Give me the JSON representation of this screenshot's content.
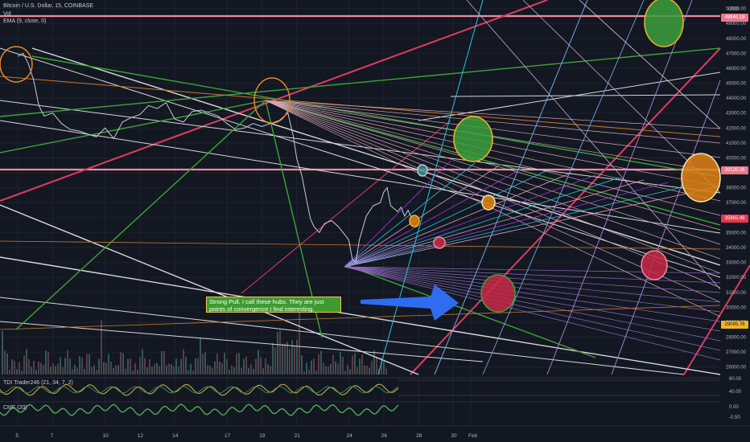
{
  "header": {
    "symbol_line": "Bitcoin / U.S. Dollar, 15, COINBASE",
    "vol_label": "Vol",
    "ema_label": "EMA (9, close, 0)",
    "currency": "USD"
  },
  "note": {
    "text": "Strong Pull. I call these hubs. They are just points of convergence I find interesting."
  },
  "indicators": {
    "tdi_label": "TDI Trader246 (21, 34, 7, 2)",
    "cmf_label": "CMF (20)"
  },
  "price_labels": [
    {
      "value": "48940.18",
      "color": "#e8788a"
    },
    {
      "value": "39120.26",
      "color": "#e8788a"
    },
    {
      "value": "35965.98",
      "color": "#e53950"
    },
    {
      "value": "29095.76",
      "color": "#f0b429"
    }
  ],
  "y_ticks": [
    "50000.00",
    "49000.00",
    "48000.00",
    "47000.00",
    "46000.00",
    "45000.00",
    "44000.00",
    "43000.00",
    "42000.00",
    "41000.00",
    "40000.00",
    "39000.00",
    "38000.00",
    "37000.00",
    "36000.00",
    "35000.00",
    "34000.00",
    "33000.00",
    "32000.00",
    "31000.00",
    "30000.00",
    "29000.00",
    "28000.00",
    "27000.00",
    "26000.00"
  ],
  "indicator_ticks": [
    "60.00",
    "40.00",
    "0.00",
    "-0.50"
  ],
  "x_ticks": [
    "5",
    "7",
    "10",
    "12",
    "14",
    "17",
    "19",
    "21",
    "24",
    "26",
    "28",
    "30",
    "Feb"
  ],
  "chart_data": {
    "type": "line",
    "title": "Bitcoin / U.S. Dollar, 15, COINBASE",
    "ylim": [
      25500,
      50300
    ],
    "y_scale": "linear",
    "grid": true,
    "price_points": [
      [
        5,
        46800
      ],
      [
        5.3,
        47000
      ],
      [
        5.6,
        46300
      ],
      [
        5.9,
        45200
      ],
      [
        6.2,
        43500
      ],
      [
        6.5,
        42800
      ],
      [
        7,
        43000
      ],
      [
        7.5,
        42300
      ],
      [
        8,
        41900
      ],
      [
        8.5,
        41800
      ],
      [
        9,
        41600
      ],
      [
        9.5,
        41400
      ],
      [
        10,
        42000
      ],
      [
        10.5,
        41300
      ],
      [
        11,
        42400
      ],
      [
        11.5,
        42700
      ],
      [
        12,
        42900
      ],
      [
        12.5,
        43500
      ],
      [
        13,
        43300
      ],
      [
        13.5,
        43700
      ],
      [
        14,
        42600
      ],
      [
        14.5,
        42400
      ],
      [
        15,
        43100
      ],
      [
        15.5,
        43200
      ],
      [
        16,
        43000
      ],
      [
        16.5,
        42800
      ],
      [
        17,
        42300
      ],
      [
        17.5,
        41900
      ],
      [
        18,
        42000
      ],
      [
        18.5,
        42300
      ],
      [
        19,
        42100
      ],
      [
        19.5,
        42300
      ],
      [
        20,
        42500
      ],
      [
        20.5,
        43000
      ],
      [
        20.8,
        41500
      ],
      [
        21,
        40000
      ],
      [
        21.3,
        38800
      ],
      [
        21.6,
        37000
      ],
      [
        21.8,
        35900
      ],
      [
        22,
        35400
      ],
      [
        22.3,
        35000
      ],
      [
        22.6,
        35600
      ],
      [
        23,
        35800
      ],
      [
        23.4,
        35400
      ],
      [
        23.8,
        34800
      ],
      [
        24,
        34500
      ],
      [
        24.2,
        33200
      ],
      [
        24.4,
        33000
      ],
      [
        24.6,
        34500
      ],
      [
        25,
        36100
      ],
      [
        25.4,
        36800
      ],
      [
        25.8,
        37000
      ],
      [
        26,
        37700
      ],
      [
        26.2,
        38000
      ],
      [
        26.4,
        36800
      ],
      [
        26.8,
        36400
      ],
      [
        27,
        36700
      ],
      [
        27.2,
        36100
      ],
      [
        27.4,
        36500
      ],
      [
        27.6,
        35966
      ]
    ],
    "annotation": "Strong Pull. I call these hubs. They are just points of convergence I find interesting."
  },
  "colors": {
    "background": "#131722",
    "price": "#c9ccd4",
    "red_trend": "#e03c5c",
    "pink_trend": "#f08aa0",
    "green_trend": "#3fa33a",
    "white_line": "#d8d8d8",
    "purple": "#9b3dd1",
    "cyan": "#26c6da",
    "arrow": "#2e6cf0"
  }
}
